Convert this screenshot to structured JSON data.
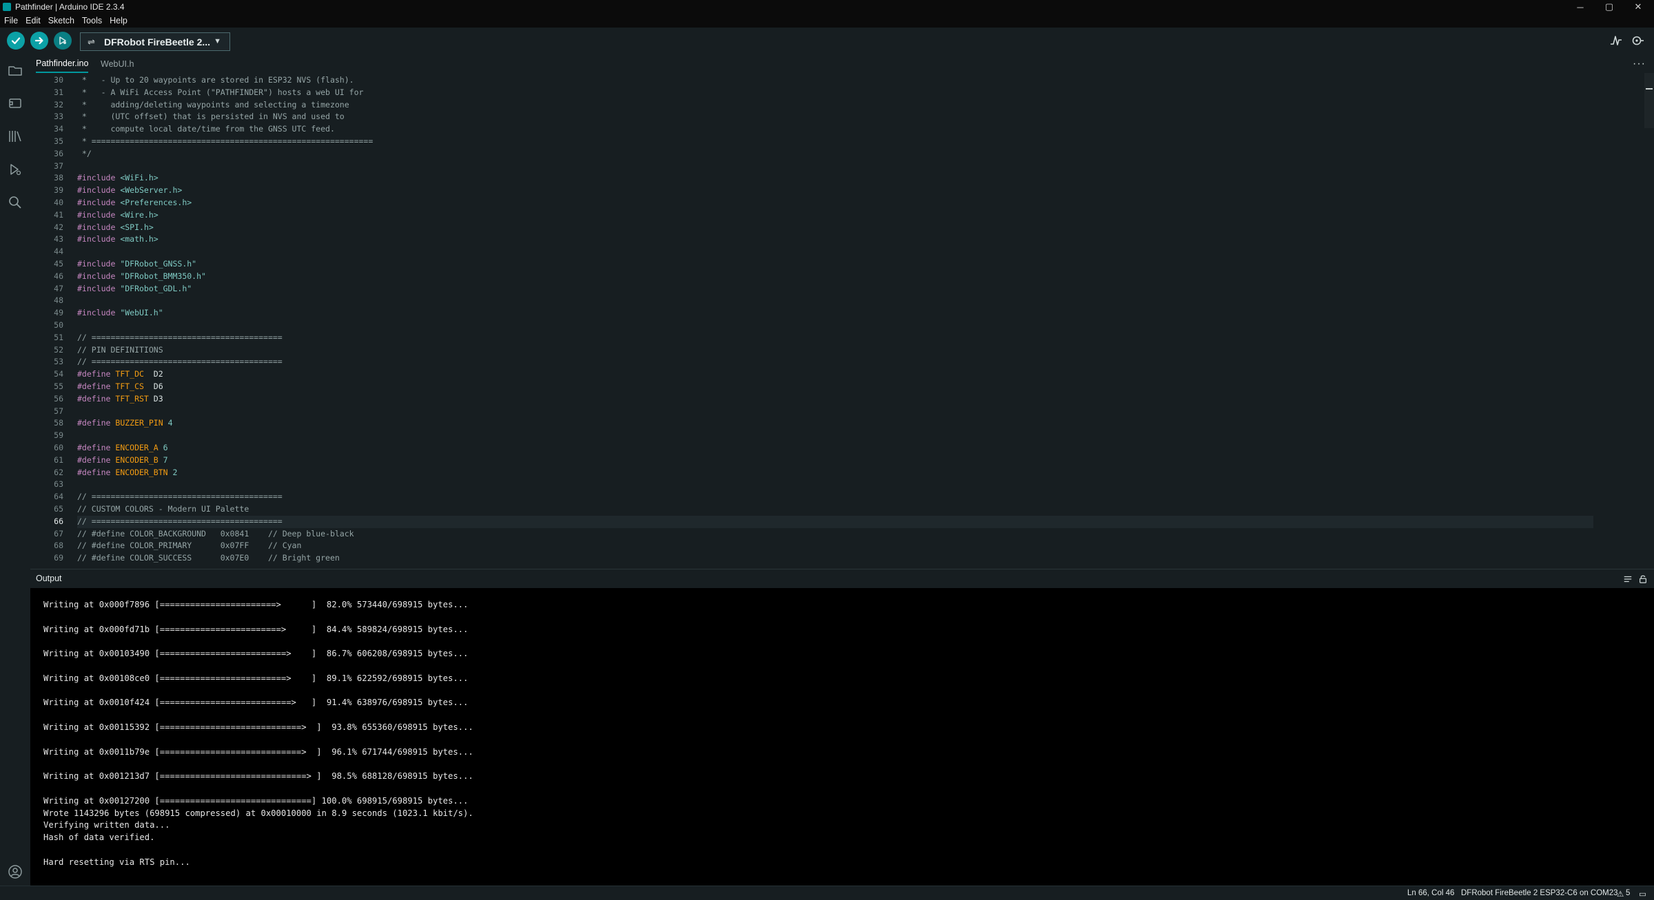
{
  "window": {
    "title": "Pathfinder | Arduino IDE 2.3.4",
    "controls": [
      "─",
      "▢",
      "✕"
    ]
  },
  "menu": {
    "items": [
      "File",
      "Edit",
      "Sketch",
      "Tools",
      "Help"
    ]
  },
  "toolbar": {
    "verify_icon": "check-icon",
    "upload_icon": "arrow-right-icon",
    "debug_icon": "debugger-icon",
    "board_label": "DFRobot FireBeetle 2...",
    "serial_plotter_icon": "serial-plotter-icon",
    "serial_monitor_icon": "serial-monitor-icon"
  },
  "sidebar": {
    "icons": [
      "folder-icon",
      "boards-manager-icon",
      "library-icon",
      "debug-icon",
      "search-icon",
      "account-icon"
    ]
  },
  "tabs": [
    {
      "label": "Pathfinder.ino",
      "active": true
    },
    {
      "label": "WebUI.h",
      "active": false
    }
  ],
  "tab_more": "···",
  "editor": {
    "current_line": 66,
    "lines": [
      {
        "n": 30,
        "segs": [
          {
            "t": " *   - Up to 20 waypoints are stored in ESP32 NVS (flash).",
            "c": "cm"
          }
        ]
      },
      {
        "n": 31,
        "segs": [
          {
            "t": " *   - A WiFi Access Point (\"PATHFINDER\") hosts a web UI for",
            "c": "cm"
          }
        ]
      },
      {
        "n": 32,
        "segs": [
          {
            "t": " *     adding/deleting waypoints and selecting a timezone",
            "c": "cm"
          }
        ]
      },
      {
        "n": 33,
        "segs": [
          {
            "t": " *     (UTC offset) that is persisted in NVS and used to",
            "c": "cm"
          }
        ]
      },
      {
        "n": 34,
        "segs": [
          {
            "t": " *     compute local date/time from the GNSS UTC feed.",
            "c": "cm"
          }
        ]
      },
      {
        "n": 35,
        "segs": [
          {
            "t": " * ===========================================================",
            "c": "cm"
          }
        ]
      },
      {
        "n": 36,
        "segs": [
          {
            "t": " */",
            "c": "cm"
          }
        ]
      },
      {
        "n": 37,
        "segs": []
      },
      {
        "n": 38,
        "segs": [
          {
            "t": "#include ",
            "c": "pp"
          },
          {
            "t": "<WiFi.h>",
            "c": "str"
          }
        ]
      },
      {
        "n": 39,
        "segs": [
          {
            "t": "#include ",
            "c": "pp"
          },
          {
            "t": "<WebServer.h>",
            "c": "str"
          }
        ]
      },
      {
        "n": 40,
        "segs": [
          {
            "t": "#include ",
            "c": "pp"
          },
          {
            "t": "<Preferences.h>",
            "c": "str"
          }
        ]
      },
      {
        "n": 41,
        "segs": [
          {
            "t": "#include ",
            "c": "pp"
          },
          {
            "t": "<Wire.h>",
            "c": "str"
          }
        ]
      },
      {
        "n": 42,
        "segs": [
          {
            "t": "#include ",
            "c": "pp"
          },
          {
            "t": "<SPI.h>",
            "c": "str"
          }
        ]
      },
      {
        "n": 43,
        "segs": [
          {
            "t": "#include ",
            "c": "pp"
          },
          {
            "t": "<math.h>",
            "c": "str"
          }
        ]
      },
      {
        "n": 44,
        "segs": []
      },
      {
        "n": 45,
        "segs": [
          {
            "t": "#include ",
            "c": "pp"
          },
          {
            "t": "\"DFRobot_GNSS.h\"",
            "c": "str"
          }
        ]
      },
      {
        "n": 46,
        "segs": [
          {
            "t": "#include ",
            "c": "pp"
          },
          {
            "t": "\"DFRobot_BMM350.h\"",
            "c": "str"
          }
        ]
      },
      {
        "n": 47,
        "segs": [
          {
            "t": "#include ",
            "c": "pp"
          },
          {
            "t": "\"DFRobot_GDL.h\"",
            "c": "str"
          }
        ]
      },
      {
        "n": 48,
        "segs": []
      },
      {
        "n": 49,
        "segs": [
          {
            "t": "#include ",
            "c": "pp"
          },
          {
            "t": "\"WebUI.h\"",
            "c": "str"
          }
        ]
      },
      {
        "n": 50,
        "segs": []
      },
      {
        "n": 51,
        "segs": [
          {
            "t": "// ========================================",
            "c": "cm"
          }
        ]
      },
      {
        "n": 52,
        "segs": [
          {
            "t": "// PIN DEFINITIONS",
            "c": "cm"
          }
        ]
      },
      {
        "n": 53,
        "segs": [
          {
            "t": "// ========================================",
            "c": "cm"
          }
        ]
      },
      {
        "n": 54,
        "segs": [
          {
            "t": "#define ",
            "c": "pp"
          },
          {
            "t": "TFT_DC",
            "c": "mac"
          },
          {
            "t": "  D2",
            "c": "plain"
          }
        ]
      },
      {
        "n": 55,
        "segs": [
          {
            "t": "#define ",
            "c": "pp"
          },
          {
            "t": "TFT_CS",
            "c": "mac"
          },
          {
            "t": "  D6",
            "c": "plain"
          }
        ]
      },
      {
        "n": 56,
        "segs": [
          {
            "t": "#define ",
            "c": "pp"
          },
          {
            "t": "TFT_RST",
            "c": "mac"
          },
          {
            "t": " D3",
            "c": "plain"
          }
        ]
      },
      {
        "n": 57,
        "segs": []
      },
      {
        "n": 58,
        "segs": [
          {
            "t": "#define ",
            "c": "pp"
          },
          {
            "t": "BUZZER_PIN",
            "c": "mac"
          },
          {
            "t": " 4",
            "c": "num"
          }
        ]
      },
      {
        "n": 59,
        "segs": []
      },
      {
        "n": 60,
        "segs": [
          {
            "t": "#define ",
            "c": "pp"
          },
          {
            "t": "ENCODER_A",
            "c": "mac"
          },
          {
            "t": " 6",
            "c": "num"
          }
        ]
      },
      {
        "n": 61,
        "segs": [
          {
            "t": "#define ",
            "c": "pp"
          },
          {
            "t": "ENCODER_B",
            "c": "mac"
          },
          {
            "t": " 7",
            "c": "num"
          }
        ]
      },
      {
        "n": 62,
        "segs": [
          {
            "t": "#define ",
            "c": "pp"
          },
          {
            "t": "ENCODER_BTN",
            "c": "mac"
          },
          {
            "t": " 2",
            "c": "num"
          }
        ]
      },
      {
        "n": 63,
        "segs": []
      },
      {
        "n": 64,
        "segs": [
          {
            "t": "// ========================================",
            "c": "cm"
          }
        ]
      },
      {
        "n": 65,
        "segs": [
          {
            "t": "// CUSTOM COLORS - Modern UI Palette",
            "c": "cm"
          }
        ]
      },
      {
        "n": 66,
        "segs": [
          {
            "t": "// ========================================",
            "c": "cm"
          }
        ]
      },
      {
        "n": 67,
        "segs": [
          {
            "t": "// #define COLOR_BACKGROUND   0x0841    // Deep blue-black",
            "c": "cm"
          }
        ]
      },
      {
        "n": 68,
        "segs": [
          {
            "t": "// #define COLOR_PRIMARY      0x07FF    // Cyan",
            "c": "cm"
          }
        ]
      },
      {
        "n": 69,
        "segs": [
          {
            "t": "// #define COLOR_SUCCESS      0x07E0    // Bright green",
            "c": "cm"
          }
        ]
      }
    ]
  },
  "output": {
    "title": "Output",
    "lines": [
      "Writing at 0x000f7896 [=======================>      ]  82.0% 573440/698915 bytes...",
      "",
      "Writing at 0x000fd71b [========================>     ]  84.4% 589824/698915 bytes...",
      "",
      "Writing at 0x00103490 [=========================>    ]  86.7% 606208/698915 bytes...",
      "",
      "Writing at 0x00108ce0 [=========================>    ]  89.1% 622592/698915 bytes...",
      "",
      "Writing at 0x0010f424 [==========================>   ]  91.4% 638976/698915 bytes...",
      "",
      "Writing at 0x00115392 [============================>  ]  93.8% 655360/698915 bytes...",
      "",
      "Writing at 0x0011b79e [============================>  ]  96.1% 671744/698915 bytes...",
      "",
      "Writing at 0x001213d7 [=============================> ]  98.5% 688128/698915 bytes...",
      "",
      "Writing at 0x00127200 [==============================] 100.0% 698915/698915 bytes...",
      "Wrote 1143296 bytes (698915 compressed) at 0x00010000 in 8.9 seconds (1023.1 kbit/s).",
      "Verifying written data...",
      "Hash of data verified.",
      "",
      "Hard resetting via RTS pin..."
    ]
  },
  "status": {
    "position": "Ln 66, Col 46",
    "board": "DFRobot FireBeetle 2 ESP32-C6 on COM23",
    "notifications": "5"
  },
  "colors": {
    "accent": "#00979d",
    "background": "#171e21",
    "output_bg": "#000000"
  }
}
